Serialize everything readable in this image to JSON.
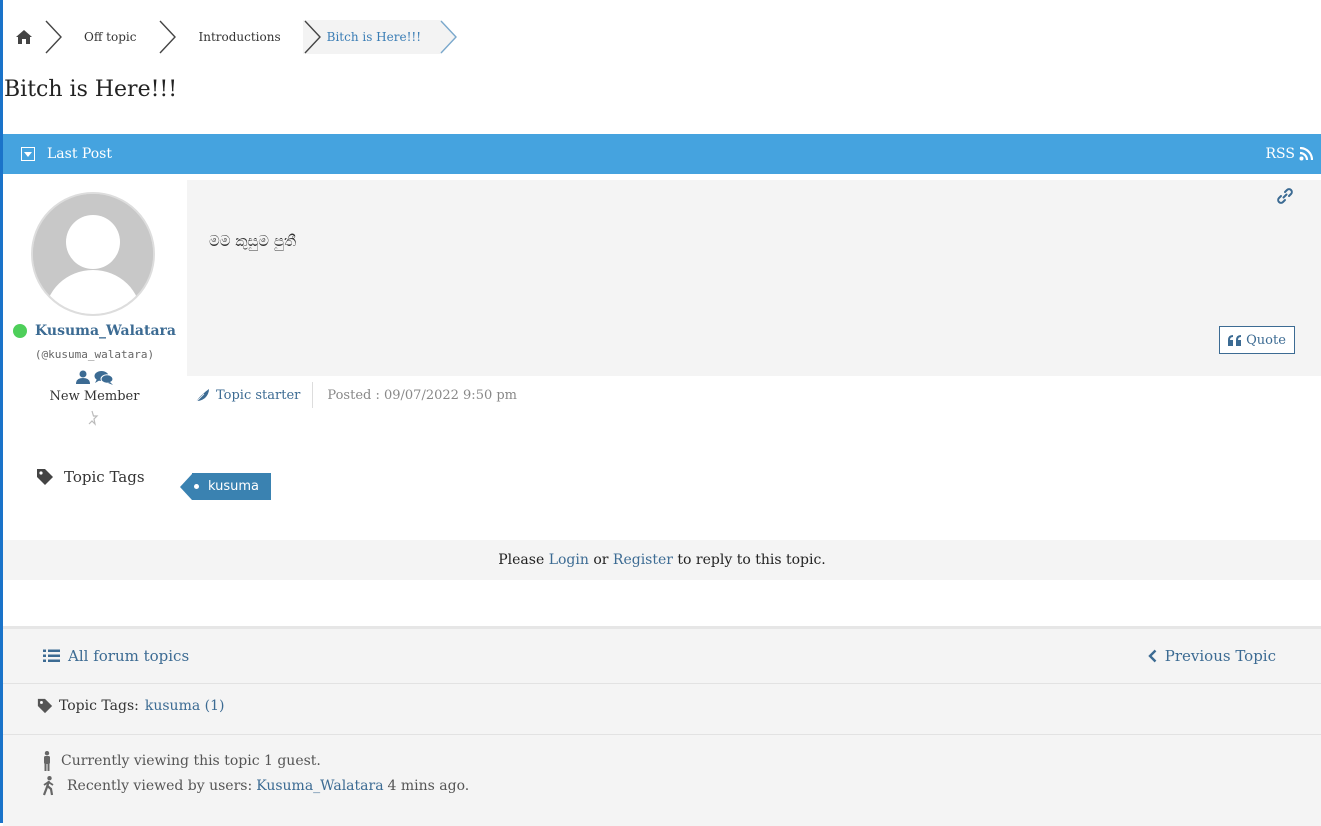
{
  "breadcrumb": {
    "items": [
      {
        "label": "Off topic"
      },
      {
        "label": "Introductions"
      },
      {
        "label": "Bitch is Here!!!"
      }
    ]
  },
  "topic": {
    "title": "Bitch is Here!!!"
  },
  "post_bar": {
    "label": "Last Post",
    "rss_label": "RSS"
  },
  "post": {
    "author": {
      "name": "Kusuma_Walatara",
      "handle": "(@kusuma_walatara)",
      "rank": "New Member",
      "status_color": "#4ecf5a"
    },
    "content": "මම කුසුම පුතී",
    "quote_label": "Quote",
    "starter_label": "Topic starter",
    "posted": "Posted : 09/07/2022 9:50 pm"
  },
  "tags": {
    "label": "Topic Tags",
    "items": [
      "kusuma"
    ]
  },
  "login_bar": {
    "prefix": "Please",
    "login": "Login",
    "or": "or",
    "register": "Register",
    "suffix": "to reply to this topic."
  },
  "footer": {
    "all_topics": "All forum topics",
    "previous_topic": "Previous Topic",
    "tags_label": "Topic Tags:",
    "tag_link": "kusuma (1)",
    "viewing": "Currently viewing this topic 1 guest.",
    "recent_prefix": "Recently viewed by users:",
    "recent_user": "Kusuma_Walatara",
    "recent_suffix": "4 mins ago."
  },
  "colors": {
    "accent": "#45a3df",
    "link": "#3c6b93",
    "tag": "#3a82b1"
  }
}
